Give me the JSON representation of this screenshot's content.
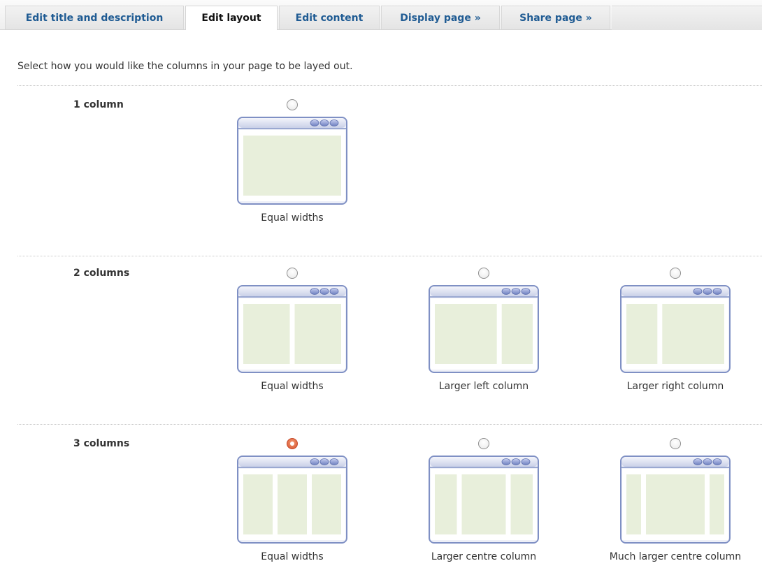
{
  "tabs": [
    {
      "label": "Edit title and description",
      "active": false
    },
    {
      "label": "Edit layout",
      "active": true
    },
    {
      "label": "Edit content",
      "active": false
    },
    {
      "label": "Display page »",
      "active": false
    },
    {
      "label": "Share page »",
      "active": false
    }
  ],
  "intro_text": "Select how you would like the columns in your page to be layed out.",
  "rows": [
    {
      "label": "1 column",
      "options": [
        {
          "label": "Equal widths",
          "columns": [
            1
          ],
          "selected": false
        }
      ]
    },
    {
      "label": "2 columns",
      "options": [
        {
          "label": "Equal widths",
          "columns": [
            1,
            1
          ],
          "selected": false
        },
        {
          "label": "Larger left column",
          "columns": [
            2,
            1
          ],
          "selected": false
        },
        {
          "label": "Larger right column",
          "columns": [
            1,
            2
          ],
          "selected": false
        }
      ]
    },
    {
      "label": "3 columns",
      "options": [
        {
          "label": "Equal widths",
          "columns": [
            1,
            1,
            1
          ],
          "selected": true
        },
        {
          "label": "Larger centre column",
          "columns": [
            1,
            2,
            1
          ],
          "selected": false
        },
        {
          "label": "Much larger centre column",
          "columns": [
            1,
            4,
            1
          ],
          "selected": false
        }
      ]
    }
  ],
  "colors": {
    "tab_link": "#1f5b93",
    "radio_selected": "#d4532e",
    "window_frame": "#7f90c4",
    "column_fill": "#e8efdb"
  },
  "icons": {
    "thumbnail": "window-layout-icon",
    "window_controls": "window-buttons-icon"
  }
}
